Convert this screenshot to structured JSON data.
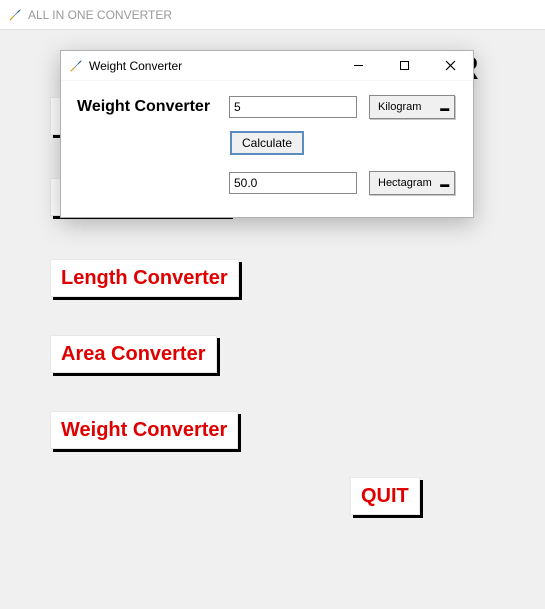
{
  "main": {
    "title": "ALL IN ONE CONVERTER",
    "hero": "ALL IN ONE CONVERTER",
    "buttons": {
      "hidden1": " ",
      "hidden2": " ",
      "length": "Length Converter",
      "area": "Area Converter",
      "weight": "Weight Converter",
      "quit": "QUIT"
    }
  },
  "dialog": {
    "title": "Weight Converter",
    "heading": "Weight Converter",
    "input_value": "5",
    "from_unit": "Kilogram",
    "calculate": "Calculate",
    "output_value": "50.0",
    "to_unit": "Hectagram"
  }
}
